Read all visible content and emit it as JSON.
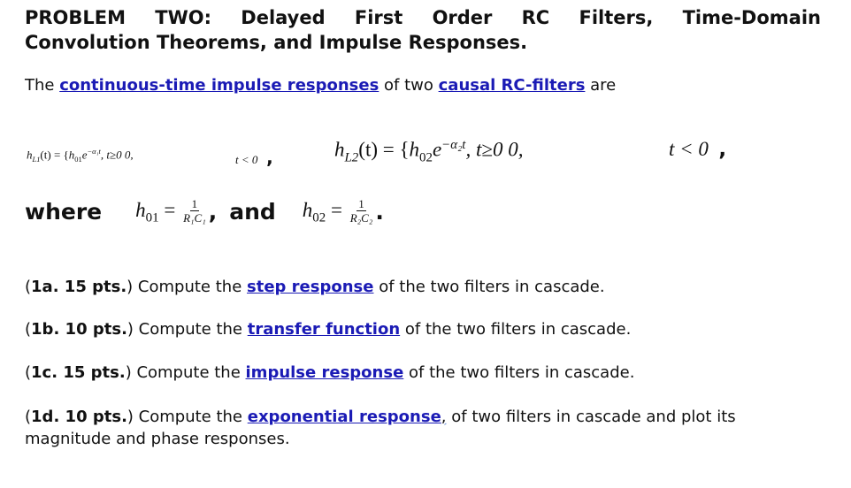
{
  "title": {
    "line1_words": [
      "PROBLEM",
      "TWO:",
      "Delayed",
      "First",
      "Order",
      "RC",
      "Filters,",
      "Time-Domain"
    ],
    "line2": "Convolution Theorems, and Impulse Responses."
  },
  "intro": {
    "prefix": "The ",
    "link1": "continuous-time impulse responses",
    "middle": " of two ",
    "link2": "causal RC-filters",
    "suffix": " are"
  },
  "equations": {
    "h1": {
      "lhs": "h",
      "lhs_sub": "L1",
      "arg": "(t) = {",
      "coef": "h",
      "coef_sub": "01",
      "exp_base": "e",
      "exp": "−α₁t",
      "cond1": ", t≥0  0,",
      "cond2": "t < 0",
      "end": ","
    },
    "h2": {
      "lhs": "h",
      "lhs_sub": "L2",
      "arg": "(t) = {",
      "coef": "h",
      "coef_sub": "02",
      "exp_base": "e",
      "exp": "−α₂t",
      "cond1": ", t≥0  0,",
      "cond2": "t < 0",
      "end": ","
    }
  },
  "where": {
    "label": "where",
    "h01": {
      "sym": "h",
      "sub": "01",
      "num": "1",
      "den": "R₁C₁"
    },
    "sep": ",",
    "and": "and",
    "h02": {
      "sym": "h",
      "sub": "02",
      "num": "1",
      "den": "R₂C₂"
    },
    "end": "."
  },
  "questions": [
    {
      "label": "1a. 15 pts.",
      "pre": " Compute the ",
      "link": "step response",
      "post": " of the two filters in cascade."
    },
    {
      "label": "1b. 10 pts.",
      "pre": " Compute the ",
      "link": "transfer function",
      "post": " of the two filters in cascade."
    },
    {
      "label": "1c. 15 pts.",
      "pre": " Compute the ",
      "link": "impulse response",
      "post": " of the two filters in cascade."
    },
    {
      "label": "1d. 10 pts.",
      "pre": " Compute the ",
      "link": "exponential response",
      "post_comma": ",",
      "post": " of two filters in cascade and plot its magnitude and phase responses."
    }
  ]
}
